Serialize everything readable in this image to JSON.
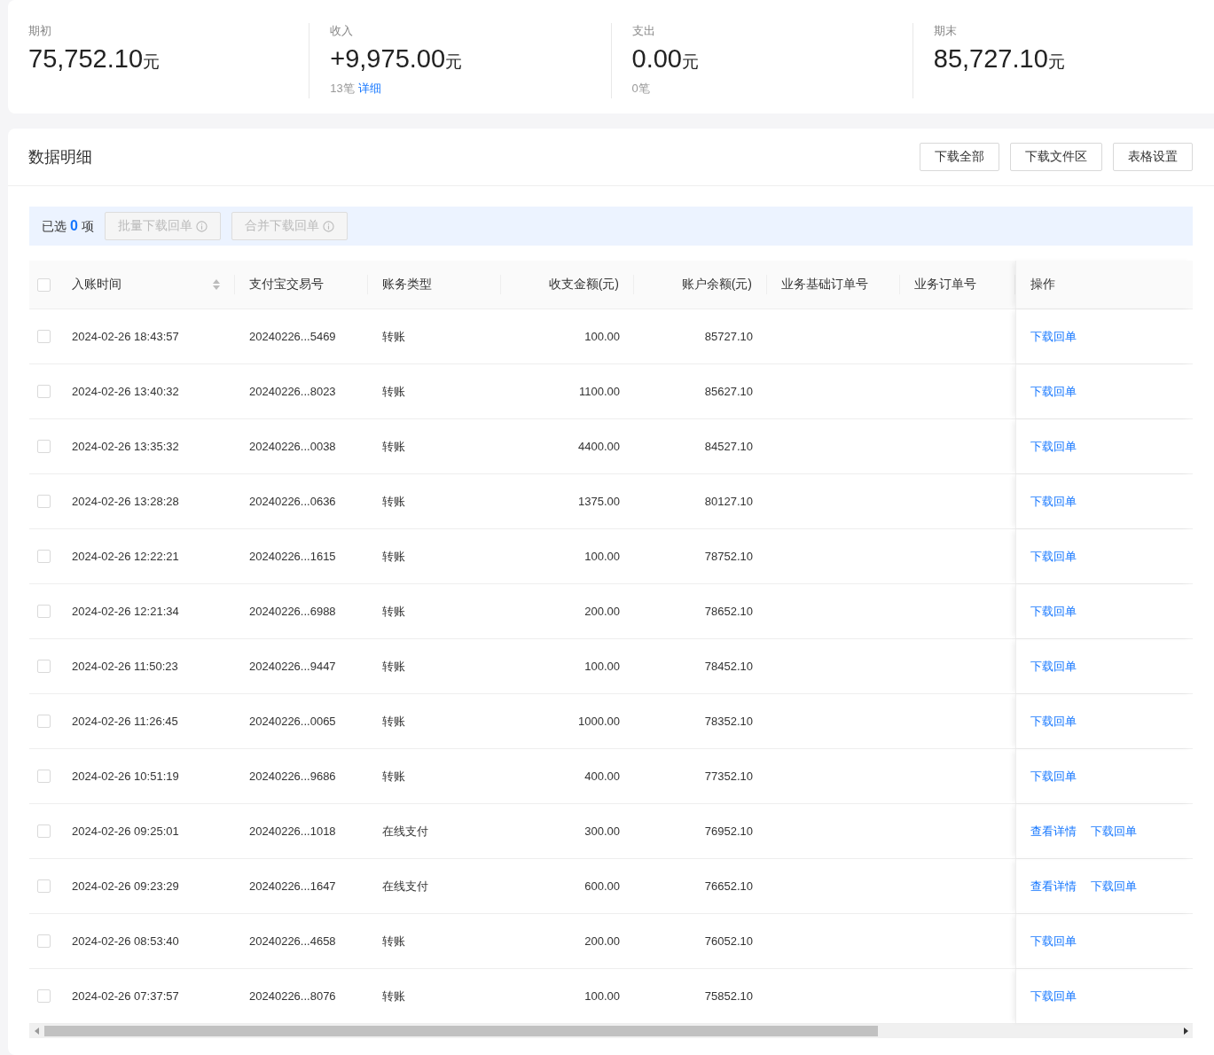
{
  "summary": [
    {
      "label": "期初",
      "amount": "75,752.10",
      "unit": "元"
    },
    {
      "label": "收入",
      "amount": "+9,975.00",
      "unit": "元",
      "count": "13笔",
      "link": "详细"
    },
    {
      "label": "支出",
      "amount": "0.00",
      "unit": "元",
      "count": "0笔"
    },
    {
      "label": "期末",
      "amount": "85,727.10",
      "unit": "元"
    }
  ],
  "section": {
    "title": "数据明细",
    "buttons": [
      "下载全部",
      "下载文件区",
      "表格设置"
    ]
  },
  "selection": {
    "prefix": "已选",
    "count": "0",
    "suffix": "项",
    "buttons": [
      {
        "label": "批量下载回单",
        "disabled": true
      },
      {
        "label": "合并下载回单",
        "disabled": true
      }
    ]
  },
  "table": {
    "all_checked": false,
    "columns": [
      {
        "label": "入账时间",
        "sortable": true,
        "kind": "text"
      },
      {
        "label": "支付宝交易号",
        "sortable": false,
        "kind": "text"
      },
      {
        "label": "账务类型",
        "sortable": false,
        "kind": "text"
      },
      {
        "label": "收支金额(元)",
        "sortable": false,
        "kind": "amount"
      },
      {
        "label": "账户余额(元)",
        "sortable": false,
        "kind": "amount"
      },
      {
        "label": "业务基础订单号",
        "sortable": false,
        "kind": "text"
      },
      {
        "label": "业务订单号",
        "sortable": false,
        "kind": "text"
      },
      {
        "label": "操作",
        "sortable": false,
        "kind": "text"
      }
    ],
    "rows": [
      {
        "checked": false,
        "cells": [
          "2024-02-26 18:43:57",
          "20240226...5469",
          "转账",
          "100.00",
          "85727.10"
        ],
        "actions": [
          "下载回单"
        ]
      },
      {
        "checked": false,
        "cells": [
          "2024-02-26 13:40:32",
          "20240226...8023",
          "转账",
          "1100.00",
          "85627.10"
        ],
        "actions": [
          "下载回单"
        ]
      },
      {
        "checked": false,
        "cells": [
          "2024-02-26 13:35:32",
          "20240226...0038",
          "转账",
          "4400.00",
          "84527.10"
        ],
        "actions": [
          "下载回单"
        ]
      },
      {
        "checked": false,
        "cells": [
          "2024-02-26 13:28:28",
          "20240226...0636",
          "转账",
          "1375.00",
          "80127.10"
        ],
        "actions": [
          "下载回单"
        ]
      },
      {
        "checked": false,
        "cells": [
          "2024-02-26 12:22:21",
          "20240226...1615",
          "转账",
          "100.00",
          "78752.10"
        ],
        "actions": [
          "下载回单"
        ]
      },
      {
        "checked": false,
        "cells": [
          "2024-02-26 12:21:34",
          "20240226...6988",
          "转账",
          "200.00",
          "78652.10"
        ],
        "actions": [
          "下载回单"
        ]
      },
      {
        "checked": false,
        "cells": [
          "2024-02-26 11:50:23",
          "20240226...9447",
          "转账",
          "100.00",
          "78452.10"
        ],
        "actions": [
          "下载回单"
        ]
      },
      {
        "checked": false,
        "cells": [
          "2024-02-26 11:26:45",
          "20240226...0065",
          "转账",
          "1000.00",
          "78352.10"
        ],
        "actions": [
          "下载回单"
        ]
      },
      {
        "checked": false,
        "cells": [
          "2024-02-26 10:51:19",
          "20240226...9686",
          "转账",
          "400.00",
          "77352.10"
        ],
        "actions": [
          "下载回单"
        ]
      },
      {
        "checked": false,
        "cells": [
          "2024-02-26 09:25:01",
          "20240226...1018",
          "在线支付",
          "300.00",
          "76952.10"
        ],
        "actions": [
          "查看详情",
          "下载回单"
        ]
      },
      {
        "checked": false,
        "cells": [
          "2024-02-26 09:23:29",
          "20240226...1647",
          "在线支付",
          "600.00",
          "76652.10"
        ],
        "actions": [
          "查看详情",
          "下载回单"
        ]
      },
      {
        "checked": false,
        "cells": [
          "2024-02-26 08:53:40",
          "20240226...4658",
          "转账",
          "200.00",
          "76052.10"
        ],
        "actions": [
          "下载回单"
        ]
      },
      {
        "checked": false,
        "cells": [
          "2024-02-26 07:37:57",
          "20240226...8076",
          "转账",
          "100.00",
          "75852.10"
        ],
        "actions": [
          "下载回单"
        ]
      }
    ]
  }
}
